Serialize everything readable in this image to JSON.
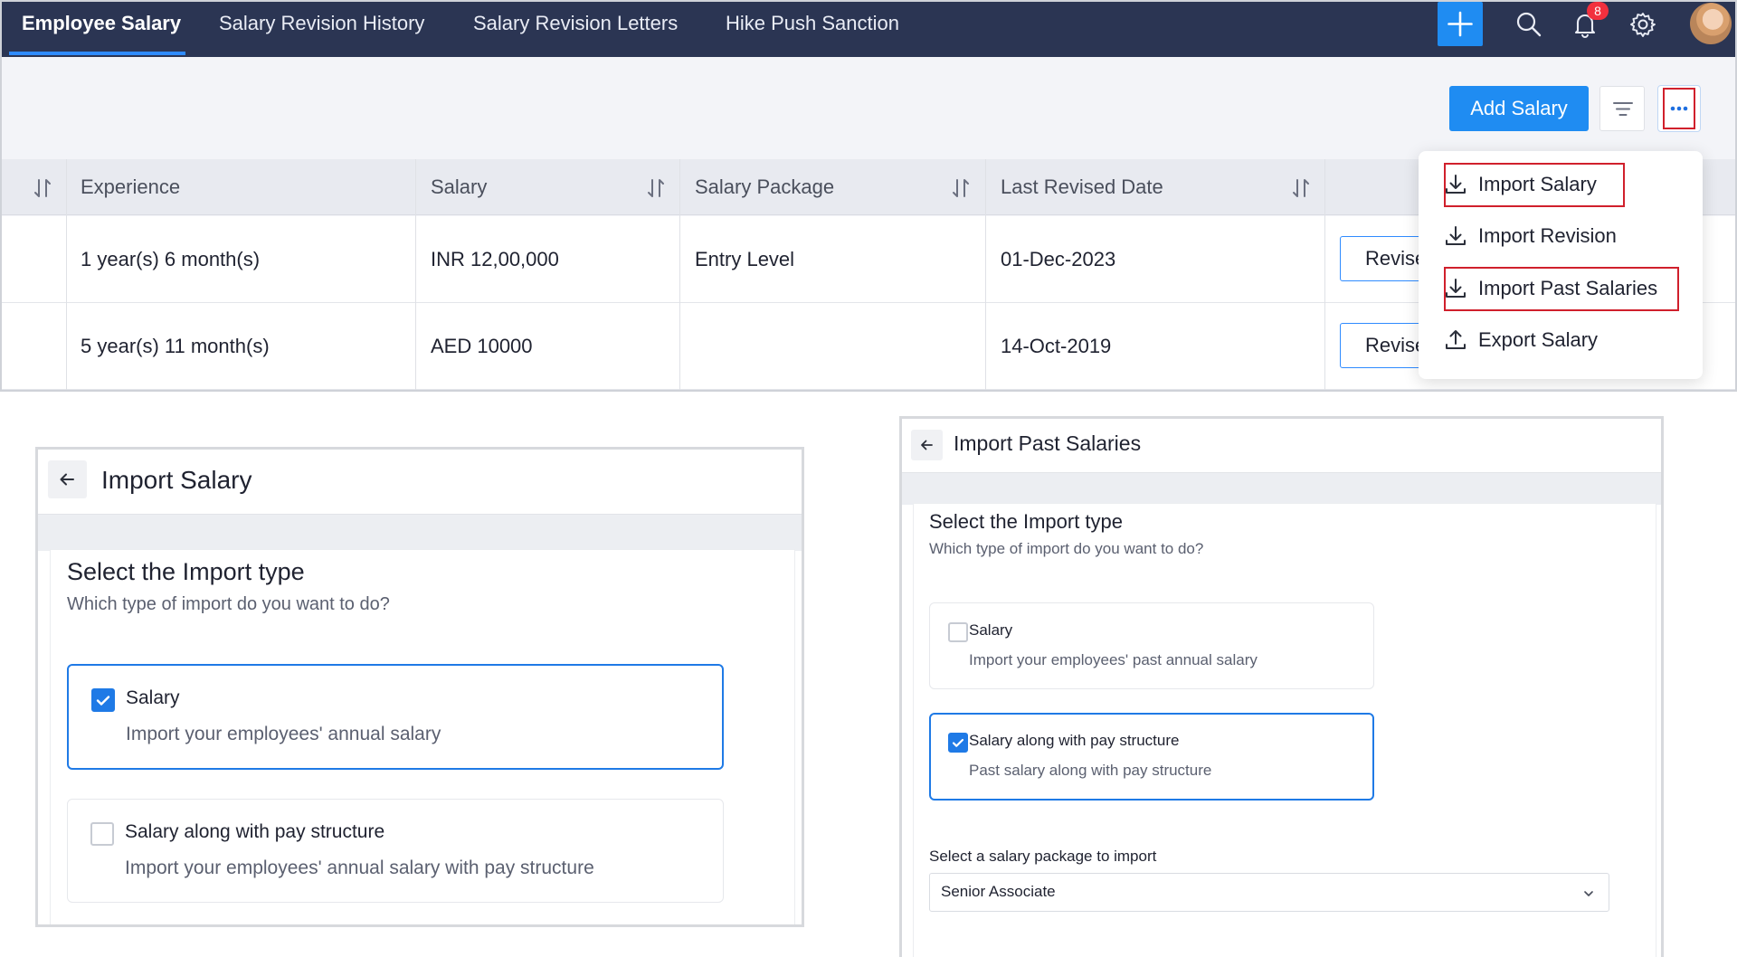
{
  "nav": {
    "tabs": [
      "Employee Salary",
      "Salary Revision History",
      "Salary Revision Letters",
      "Hike Push Sanction"
    ],
    "active_tab": "Employee Salary",
    "notification_count": "8",
    "icons": [
      "plus-icon",
      "search-icon",
      "bell-icon",
      "gear-icon",
      "avatar"
    ]
  },
  "toolbar": {
    "add_salary_label": "Add Salary",
    "icons": [
      "filter-icon",
      "more-icon"
    ]
  },
  "table": {
    "columns": [
      "Experience",
      "Salary",
      "Salary Package",
      "Last Revised Date"
    ],
    "rows": [
      {
        "experience": "1 year(s) 6 month(s)",
        "salary": "INR 12,00,000",
        "package": "Entry Level",
        "last_revised": "01-Dec-2023",
        "action": "Revise"
      },
      {
        "experience": "5 year(s) 11 month(s)",
        "salary": "AED 10000",
        "package": "",
        "last_revised": "14-Oct-2019",
        "action": "Revise"
      }
    ]
  },
  "more_menu": {
    "items": [
      {
        "label": "Import Salary",
        "icon": "download-icon"
      },
      {
        "label": "Import Revision",
        "icon": "download-icon"
      },
      {
        "label": "Import Past Salaries",
        "icon": "download-icon"
      },
      {
        "label": "Export Salary",
        "icon": "upload-icon"
      }
    ]
  },
  "import_salary_panel": {
    "title": "Import Salary",
    "heading": "Select the Import type",
    "subheading": "Which type of import do you want to do?",
    "options": [
      {
        "title": "Salary",
        "desc": "Import your employees' annual salary",
        "checked": true
      },
      {
        "title": "Salary along with pay structure",
        "desc": "Import your employees' annual salary with pay structure",
        "checked": false
      }
    ]
  },
  "import_past_panel": {
    "title": "Import Past Salaries",
    "heading": "Select the Import type",
    "subheading": "Which type of import do you want to do?",
    "options": [
      {
        "title": "Salary",
        "desc": "Import your employees' past annual salary",
        "checked": false
      },
      {
        "title": "Salary along with pay structure",
        "desc": "Past salary along with pay structure",
        "checked": true
      }
    ],
    "package_label": "Select a salary package to import",
    "package_value": "Senior Associate"
  },
  "colors": {
    "accent": "#1f8cf2",
    "navbar": "#2b3553",
    "highlight": "#d0202c",
    "badge": "#f2303e"
  }
}
